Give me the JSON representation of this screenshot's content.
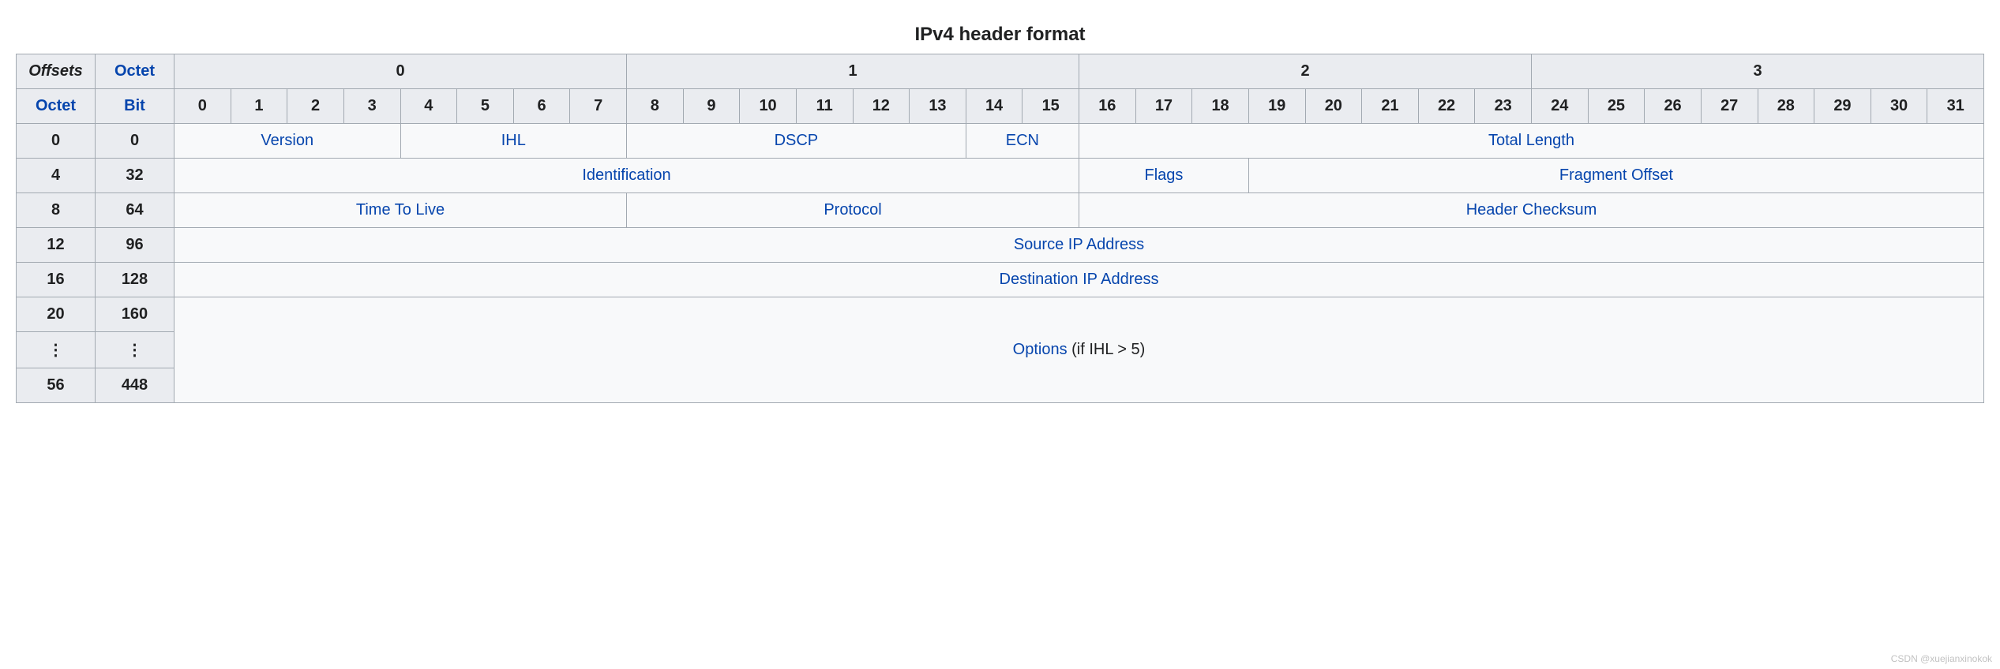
{
  "caption": "IPv4 header format",
  "headers": {
    "offsets": "Offsets",
    "octet": "Octet",
    "bit": "Bit",
    "octet_groups": [
      "0",
      "1",
      "2",
      "3"
    ],
    "bits": [
      "0",
      "1",
      "2",
      "3",
      "4",
      "5",
      "6",
      "7",
      "8",
      "9",
      "10",
      "11",
      "12",
      "13",
      "14",
      "15",
      "16",
      "17",
      "18",
      "19",
      "20",
      "21",
      "22",
      "23",
      "24",
      "25",
      "26",
      "27",
      "28",
      "29",
      "30",
      "31"
    ]
  },
  "rows": {
    "r0": {
      "octet": "0",
      "bit": "0"
    },
    "r1": {
      "octet": "4",
      "bit": "32"
    },
    "r2": {
      "octet": "8",
      "bit": "64"
    },
    "r3": {
      "octet": "12",
      "bit": "96"
    },
    "r4": {
      "octet": "16",
      "bit": "128"
    },
    "r5": {
      "octet": "20",
      "bit": "160"
    },
    "r6": {
      "octet": "⋮",
      "bit": "⋮"
    },
    "r7": {
      "octet": "56",
      "bit": "448"
    }
  },
  "fields": {
    "version": "Version",
    "ihl": "IHL",
    "dscp": "DSCP",
    "ecn": "ECN",
    "total_length": "Total Length",
    "identification": "Identification",
    "flags": "Flags",
    "fragment_offset": "Fragment Offset",
    "ttl": "Time To Live",
    "protocol": "Protocol",
    "checksum": "Header Checksum",
    "src": "Source IP Address",
    "dst": "Destination IP Address",
    "options": "Options",
    "options_after": " (if IHL > 5)"
  },
  "watermark": "CSDN @xuejianxinokok"
}
